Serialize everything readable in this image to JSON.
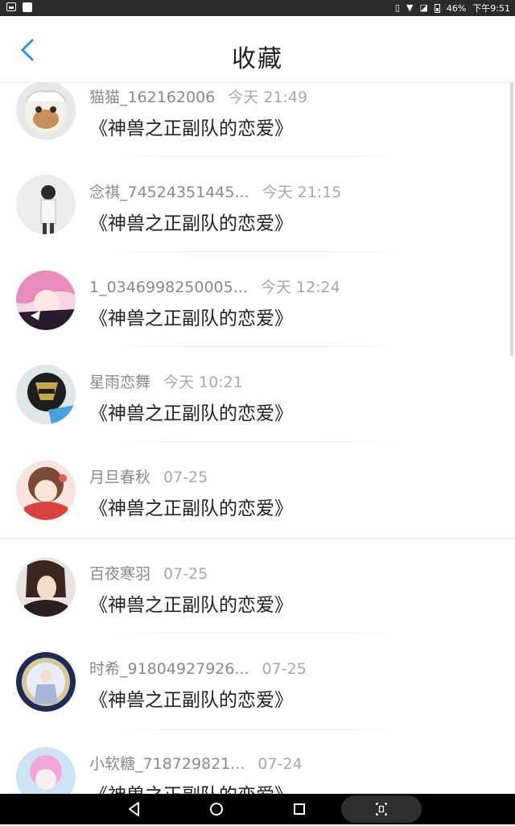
{
  "status_bar": {
    "battery": "46%",
    "time": "下午9:51"
  },
  "header": {
    "title": "收藏"
  },
  "favorites": [
    {
      "user": "猫猫_162162006",
      "time": "今天 21:49",
      "book": "《神兽之正副队的恋爱》"
    },
    {
      "user": "念祺_74524351445...",
      "time": "今天 21:15",
      "book": "《神兽之正副队的恋爱》"
    },
    {
      "user": "1_0346998250005...",
      "time": "今天 12:24",
      "book": "《神兽之正副队的恋爱》"
    },
    {
      "user": "星雨恋舞",
      "time": "今天 10:21",
      "book": "《神兽之正副队的恋爱》"
    },
    {
      "user": "月旦春秋",
      "time": "07-25",
      "book": "《神兽之正副队的恋爱》"
    },
    {
      "user": "百夜寒羽",
      "time": "07-25",
      "book": "《神兽之正副队的恋爱》"
    },
    {
      "user": "时希_91804927926...",
      "time": "07-25",
      "book": "《神兽之正副队的恋爱》"
    },
    {
      "user": "小软糖_718729821...",
      "time": "07-24",
      "book": "《神兽之正副队的恋爱》"
    }
  ],
  "colors": {
    "accent": "#2196f3",
    "title_text": "#222222",
    "meta_text": "#8a8a8a"
  }
}
